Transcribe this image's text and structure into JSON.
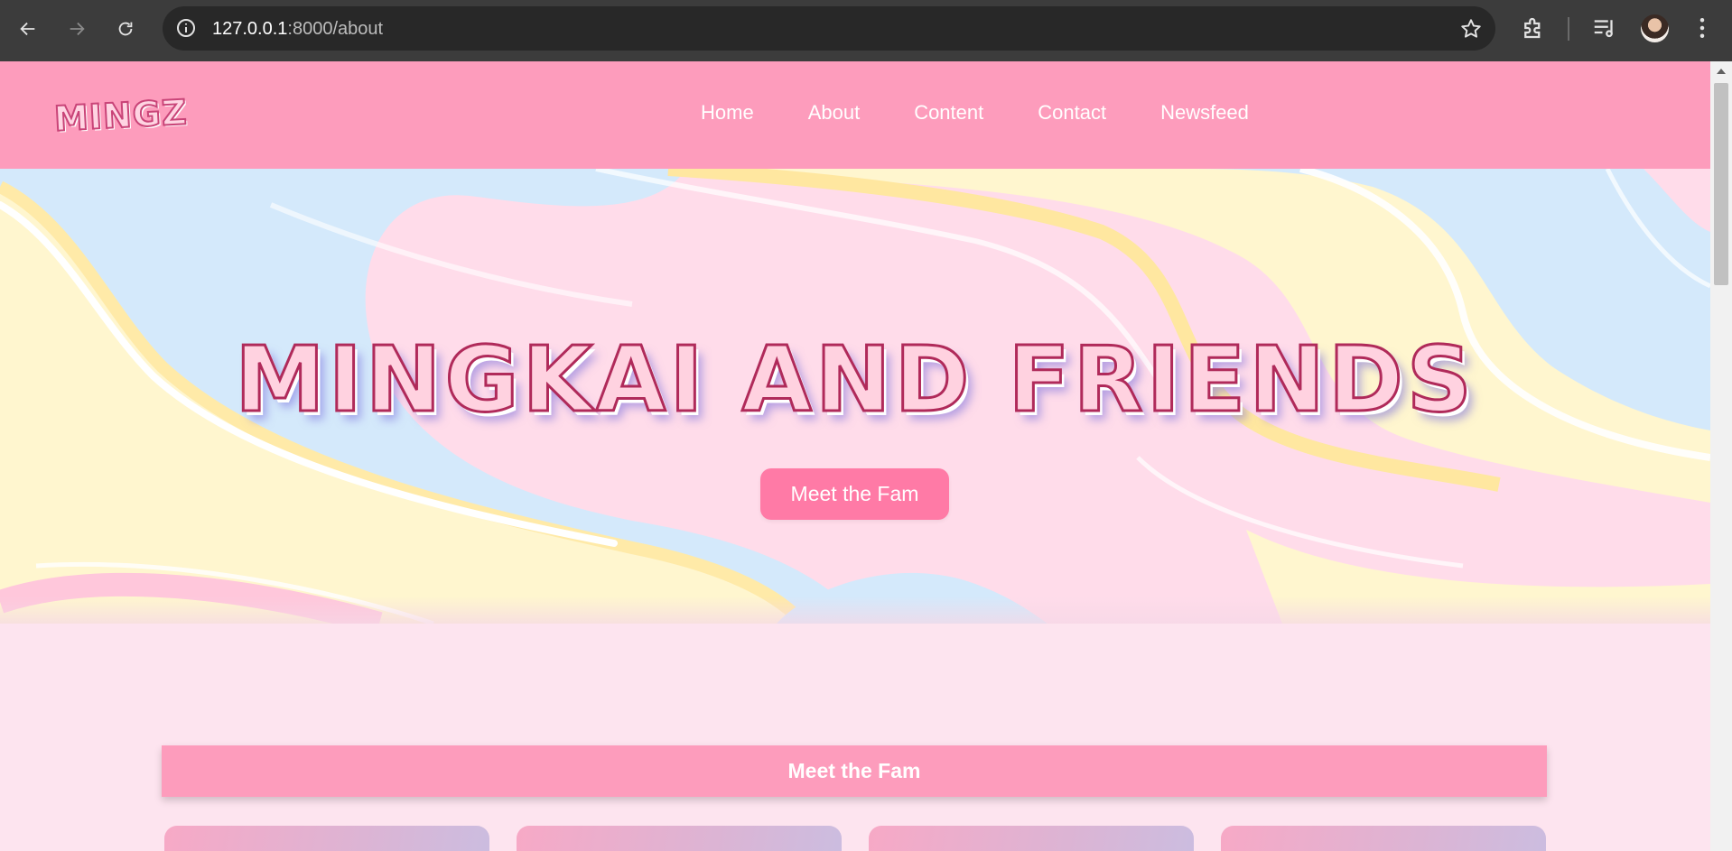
{
  "browser": {
    "url_host": "127.0.0.1",
    "url_path": ":8000/about"
  },
  "site": {
    "logo_text": "MINGZ",
    "nav": [
      {
        "label": "Home"
      },
      {
        "label": "About"
      },
      {
        "label": "Content"
      },
      {
        "label": "Contact"
      },
      {
        "label": "Newsfeed"
      }
    ]
  },
  "hero": {
    "title": "MINGKAI AND FRIENDS",
    "cta_label": "Meet the Fam"
  },
  "section": {
    "heading": "Meet the Fam"
  },
  "colors": {
    "header_pink": "#fd9cbc",
    "button_pink": "#ff7aa6",
    "page_bg": "#fde4ef",
    "wave_blue": "#d4e9fb",
    "wave_yellow": "#fff6cf",
    "wave_pink": "#ffdcea"
  }
}
